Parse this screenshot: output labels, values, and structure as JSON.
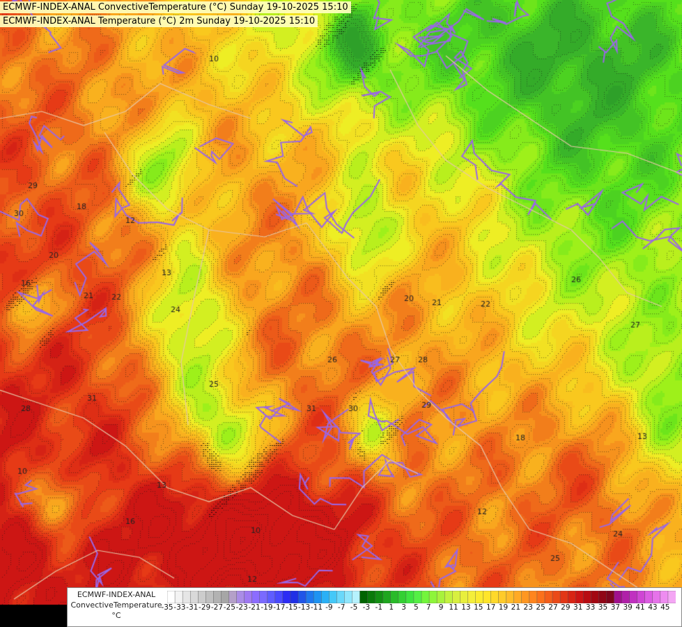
{
  "header": {
    "line1": "ECMWF-INDEX-ANAL ConvectiveTemperature (°C) Sunday 19-10-2025 15:10",
    "line2": "ECMWF-INDEX-ANAL Temperature (°C) 2m Sunday 19-10-2025 15:10"
  },
  "legend": {
    "model": "ECMWF-INDEX-ANAL",
    "parameter": "ConvectiveTemperature",
    "unit": "°C",
    "tick_labels": [
      "-35",
      "-33",
      "-31",
      "-29",
      "-27",
      "-25",
      "-23",
      "-21",
      "-19",
      "-17",
      "-15",
      "-13",
      "-11",
      "-9",
      "-7",
      "-5",
      "-3",
      "-1",
      "1",
      "3",
      "5",
      "7",
      "9",
      "11",
      "13",
      "15",
      "17",
      "19",
      "21",
      "23",
      "25",
      "27",
      "29",
      "31",
      "33",
      "35",
      "37",
      "39",
      "41",
      "43",
      "45"
    ],
    "colors": [
      "#ffffff",
      "#f3f3f3",
      "#e6e6e6",
      "#d9d9d9",
      "#cccccc",
      "#bfbfbf",
      "#b2b2b2",
      "#a6a6a6",
      "#b4a0c8",
      "#aa8ce6",
      "#9f79f2",
      "#8c6cff",
      "#7a6aff",
      "#5f5dff",
      "#4a4aff",
      "#2c2cf5",
      "#1f2fe6",
      "#1f55e8",
      "#1e78ee",
      "#1e93f2",
      "#2ab0f6",
      "#44c8f8",
      "#6ad8fa",
      "#8fe6fc",
      "#b6f2fe",
      "#006400",
      "#0a7a0a",
      "#138f13",
      "#1fa61f",
      "#29bb29",
      "#33d033",
      "#3ee43e",
      "#54f044",
      "#73f53b",
      "#8ef53a",
      "#a8f23c",
      "#c2f23e",
      "#d8f03f",
      "#e8ef3d",
      "#f4ee3a",
      "#fbeb2f",
      "#ffe52a",
      "#ffd92a",
      "#ffcb2a",
      "#ffbc2a",
      "#ffaa26",
      "#ff9722",
      "#ff851e",
      "#fb711b",
      "#f45e1a",
      "#eb4a18",
      "#e23616",
      "#d82414",
      "#cc1414",
      "#b80c12",
      "#a30812",
      "#900616",
      "#7e061c",
      "#a0108c",
      "#b020a8",
      "#c030c0",
      "#cf45d4",
      "#dc5ce2",
      "#e673ea",
      "#ee8cf0",
      "#f4a6f4"
    ],
    "map_colors": {
      "green_dark": "#3ab52a",
      "green": "#55e01c",
      "green_light": "#9ef01a",
      "yellow": "#eeee24",
      "orange": "#f9a61e",
      "orange_red": "#ef6a1a",
      "red": "#e63a16",
      "contour_purple": "#9a66e6",
      "border": "#e8c8a8"
    },
    "map_labels": [
      "10",
      "12",
      "13",
      "16",
      "18",
      "20",
      "21",
      "22",
      "24",
      "25",
      "26",
      "27",
      "28",
      "29",
      "30",
      "31"
    ]
  }
}
